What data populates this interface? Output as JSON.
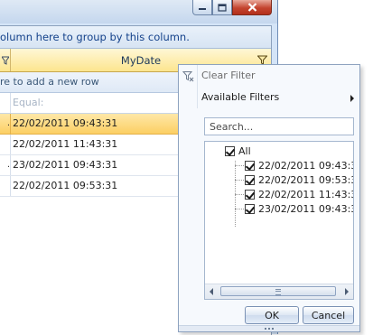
{
  "grid": {
    "group_panel_text": "olumn here to group by this column.",
    "column_header": "MyDate",
    "new_row_text": "re to add a new row",
    "filter_placeholder": "Equal:",
    "rows": [
      {
        "left": ".",
        "value": "22/02/2011 09:43:31",
        "selected": true
      },
      {
        "left": "",
        "value": "22/02/2011 11:43:31",
        "selected": false
      },
      {
        "left": ".",
        "value": "23/02/2011 09:43:31",
        "selected": false
      },
      {
        "left": "",
        "value": "22/02/2011 09:53:31",
        "selected": false
      }
    ]
  },
  "filter_popup": {
    "clear_filter": "Clear Filter",
    "available_filters": "Available Filters",
    "search_placeholder": "Search...",
    "tree": {
      "all_label": "All",
      "items": [
        "22/02/2011 09:43:31",
        "22/02/2011 09:53:31",
        "22/02/2011 11:43:31",
        "23/02/2011 09:43:31"
      ]
    },
    "ok_label": "OK",
    "cancel_label": "Cancel"
  },
  "icons": {
    "minimize": "minimize-icon",
    "maximize": "maximize-icon",
    "close": "close-icon",
    "filter": "filter-funnel-icon",
    "clear_filter": "clear-filter-icon"
  }
}
